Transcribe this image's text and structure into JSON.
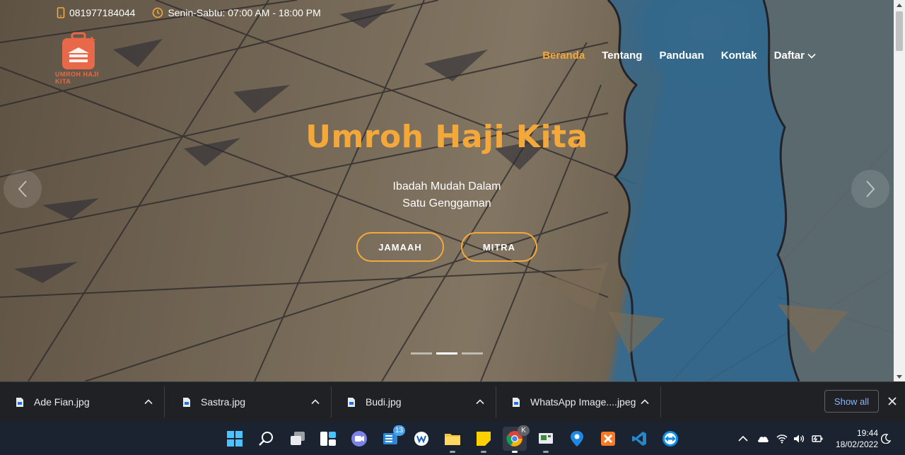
{
  "topbar": {
    "phone": "081977184044",
    "hours": "Senin-Sabtu: 07:00 AM - 18:00 PM"
  },
  "logo": {
    "text": "UMROH HAJI KITA"
  },
  "nav": {
    "items": [
      {
        "label": "Beranda",
        "active": true
      },
      {
        "label": "Tentang",
        "active": false
      },
      {
        "label": "Panduan",
        "active": false
      },
      {
        "label": "Kontak",
        "active": false
      },
      {
        "label": "Daftar",
        "active": false,
        "dropdown": true
      }
    ]
  },
  "hero": {
    "title": "Umroh Haji Kita",
    "subtitle_line1": "Ibadah Mudah Dalam",
    "subtitle_line2": "Satu Genggaman",
    "button_jamaah": "JAMAAH",
    "button_mitra": "MITRA",
    "slides": 3,
    "active_slide": 2
  },
  "downloads": {
    "items": [
      {
        "name": "Ade Fian.jpg"
      },
      {
        "name": "Sastra.jpg"
      },
      {
        "name": "Budi.jpg"
      },
      {
        "name": "WhatsApp Image....jpeg"
      }
    ],
    "show_all": "Show all"
  },
  "taskbar": {
    "mail_badge": "13",
    "chrome_profile": "K",
    "time": "19:44",
    "date": "18/02/2022"
  },
  "colors": {
    "accent": "#f4a83a",
    "link_blue": "#8ab4f8",
    "taskbar": "#1b2230",
    "shelf": "#202124"
  }
}
